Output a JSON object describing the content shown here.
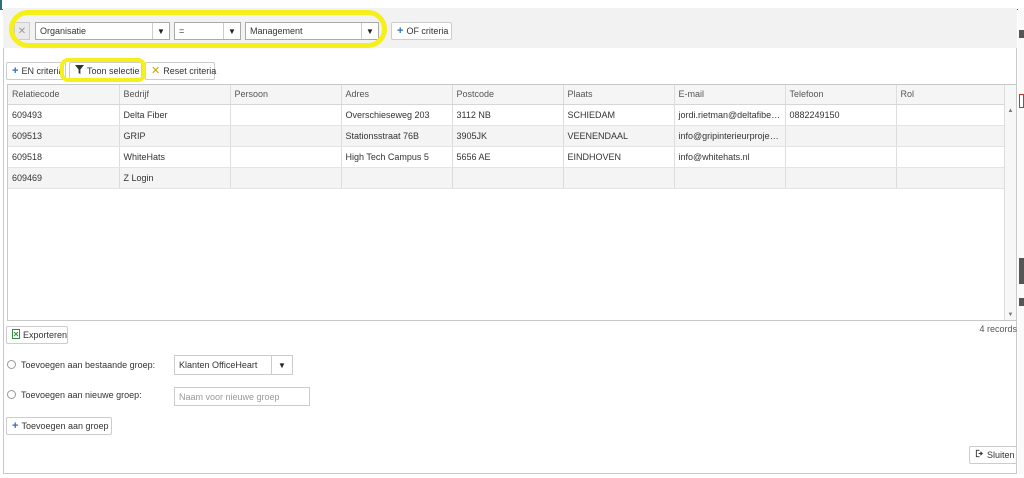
{
  "criteria": {
    "field_value": "Organisatie",
    "operator_value": "=",
    "value_value": "Management",
    "or_button": "OF criteria",
    "remove_icon": "close-icon"
  },
  "toolbar": {
    "and_button": "EN criteria",
    "show_button": "Toon selectie",
    "reset_button": "Reset criteria"
  },
  "table": {
    "columns": [
      "Relatiecode",
      "Bedrijf",
      "Persoon",
      "Adres",
      "Postcode",
      "Plaats",
      "E-mail",
      "Telefoon",
      "Rol"
    ],
    "rows": [
      [
        "609493",
        "Delta Fiber",
        "",
        "Overschieseweg 203",
        "3112 NB",
        "SCHIEDAM",
        "jordi.rietman@deltafiber.nl",
        "0882249150",
        ""
      ],
      [
        "609513",
        "GRIP",
        "",
        "Stationsstraat 76B",
        "3905JK",
        "VEENENDAAL",
        "info@gripinterieurprojecten.nl",
        "",
        ""
      ],
      [
        "609518",
        "WhiteHats",
        "",
        "High Tech Campus 5",
        "5656 AE",
        "EINDHOVEN",
        "info@whitehats.nl",
        "",
        ""
      ],
      [
        "609469",
        "Z Login",
        "",
        "",
        "",
        "",
        "",
        "",
        ""
      ]
    ]
  },
  "export_button": "Exporteren",
  "records_count": "4 records",
  "group": {
    "existing_label": "Toevoegen aan bestaande groep:",
    "existing_value": "Klanten OfficeHeart",
    "new_label": "Toevoegen aan nieuwe groep:",
    "new_placeholder": "Naam voor nieuwe groep",
    "add_button": "Toevoegen aan groep"
  },
  "close_button": "Sluiten"
}
